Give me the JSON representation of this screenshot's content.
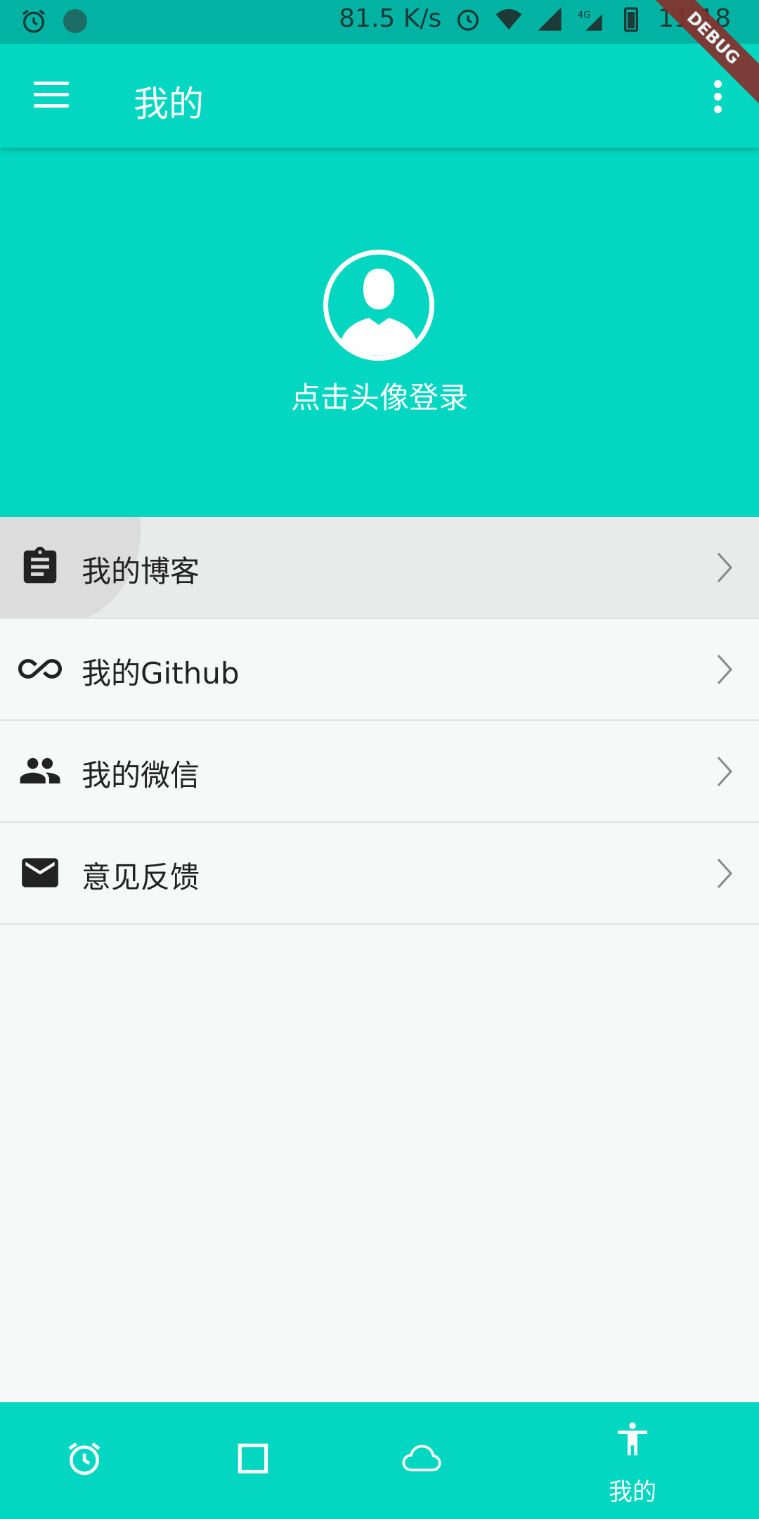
{
  "status_bar": {
    "network_speed": "81.5 K/s",
    "time": "11:18",
    "icons": [
      "alarm-icon",
      "dot-icon",
      "alarm-icon",
      "wifi-icon",
      "signal-icon",
      "4g-icon",
      "signal-icon",
      "battery-icon"
    ]
  },
  "debug_banner": "DEBUG",
  "app_bar": {
    "title": "我的",
    "menu_icon": "hamburger-menu-icon",
    "more_icon": "more-vert-icon"
  },
  "header": {
    "avatar_icon": "person-avatar-icon",
    "login_text": "点击头像登录"
  },
  "menu_items": [
    {
      "label": "我的博客",
      "icon": "assignment-icon",
      "chevron": "chevron-right-icon"
    },
    {
      "label": "我的Github",
      "icon": "infinity-icon",
      "chevron": "chevron-right-icon"
    },
    {
      "label": "我的微信",
      "icon": "people-icon",
      "chevron": "chevron-right-icon"
    },
    {
      "label": "意见反馈",
      "icon": "mail-icon",
      "chevron": "chevron-right-icon"
    }
  ],
  "bottom_nav": {
    "items": [
      {
        "icon": "alarm-icon",
        "label": ""
      },
      {
        "icon": "square-icon",
        "label": ""
      },
      {
        "icon": "cloud-icon",
        "label": ""
      },
      {
        "icon": "accessibility-icon",
        "label": "我的",
        "selected": true
      }
    ]
  },
  "colors": {
    "primary": "#03d6c1",
    "status_bar": "#02b3a3",
    "background": "#f7f8f8",
    "text": "#222222"
  }
}
